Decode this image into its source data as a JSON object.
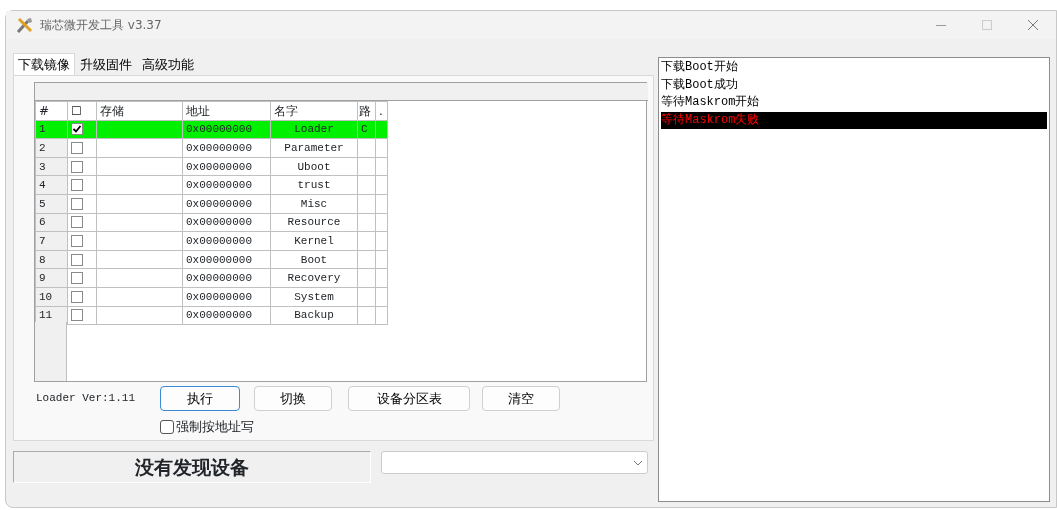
{
  "window": {
    "title": "瑞芯微开发工具 v3.37"
  },
  "tabs": [
    {
      "label": "下载镜像",
      "selected": true
    },
    {
      "label": "升级固件",
      "selected": false
    },
    {
      "label": "高级功能",
      "selected": false
    }
  ],
  "table": {
    "columns": [
      "#",
      "☐",
      "存储",
      "地址",
      "名字",
      "路",
      "."
    ],
    "rows": [
      {
        "number": "1",
        "checked": true,
        "storage": "",
        "address": "0x00000000",
        "name": "Loader",
        "column_6": "C",
        "selected": true
      },
      {
        "number": "2",
        "checked": false,
        "storage": "",
        "address": "0x00000000",
        "name": "Parameter",
        "selected": false
      },
      {
        "number": "3",
        "checked": false,
        "storage": "",
        "address": "0x00000000",
        "name": "Uboot",
        "selected": false
      },
      {
        "number": "4",
        "checked": false,
        "storage": "",
        "address": "0x00000000",
        "name": "trust",
        "selected": false
      },
      {
        "number": "5",
        "checked": false,
        "storage": "",
        "address": "0x00000000",
        "name": "Misc",
        "selected": false
      },
      {
        "number": "6",
        "checked": false,
        "storage": "",
        "address": "0x00000000",
        "name": "Resource",
        "selected": false
      },
      {
        "number": "7",
        "checked": false,
        "storage": "",
        "address": "0x00000000",
        "name": "Kernel",
        "selected": false
      },
      {
        "number": "8",
        "checked": false,
        "storage": "",
        "address": "0x00000000",
        "name": "Boot",
        "selected": false
      },
      {
        "number": "9",
        "checked": false,
        "storage": "",
        "address": "0x00000000",
        "name": "Recovery",
        "selected": false
      },
      {
        "number": "10",
        "checked": false,
        "storage": "",
        "address": "0x00000000",
        "name": "System",
        "selected": false
      },
      {
        "number": "11",
        "checked": false,
        "storage": "",
        "address": "0x00000000",
        "name": "Backup",
        "selected": false
      }
    ]
  },
  "loader_version": "Loader Ver:1.11",
  "buttons": [
    {
      "label": "执行",
      "focused": true
    },
    {
      "label": "切换",
      "focused": false
    },
    {
      "label": "设备分区表",
      "focused": false
    },
    {
      "label": "清空",
      "focused": false
    }
  ],
  "force_address_write": {
    "label": "强制按地址写",
    "checked": false
  },
  "status": "没有发现设备",
  "log": [
    {
      "text": "下载Boot开始",
      "selected": false
    },
    {
      "text": "下载Boot成功",
      "selected": false
    },
    {
      "text": "等待Maskrom开始",
      "selected": false
    },
    {
      "text": "等待Maskrom失败",
      "selected": true
    }
  ]
}
